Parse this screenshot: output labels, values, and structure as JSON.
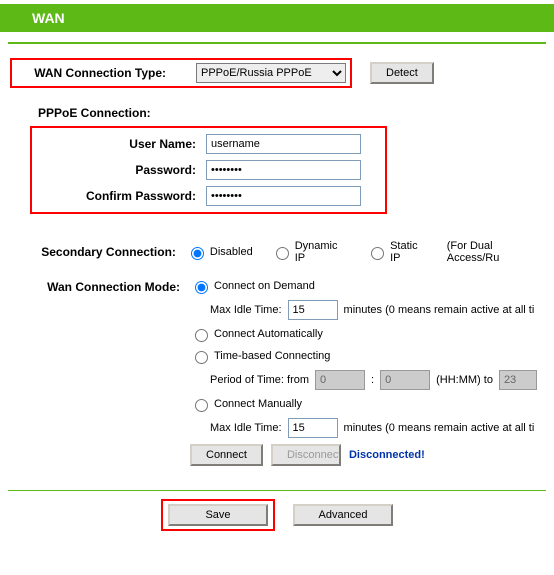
{
  "header": {
    "title": "WAN"
  },
  "wanType": {
    "label": "WAN Connection Type:",
    "selected": "PPPoE/Russia PPPoE",
    "detect": "Detect"
  },
  "pppoe": {
    "sectionTitle": "PPPoE Connection:",
    "userLabel": "User Name:",
    "userValue": "username",
    "passLabel": "Password:",
    "passValue": "password",
    "confirmLabel": "Confirm Password:",
    "confirmValue": "password"
  },
  "secondary": {
    "label": "Secondary Connection:",
    "opt1": "Disabled",
    "opt2": "Dynamic IP",
    "opt3": "Static IP",
    "note": "(For Dual Access/Ru"
  },
  "mode": {
    "label": "Wan Connection Mode:",
    "opt1": "Connect on Demand",
    "maxIdleLabel1": "Max Idle Time:",
    "maxIdleVal1": "15",
    "minutesNote": "minutes (0 means remain active at all ti",
    "opt2": "Connect Automatically",
    "opt3": "Time-based Connecting",
    "periodLabel": "Period of Time: from",
    "periodFrom": "0",
    "periodTo": "0",
    "hhmm": "(HH:MM) to",
    "periodEnd": "23",
    "opt4": "Connect Manually",
    "maxIdleLabel2": "Max Idle Time:",
    "maxIdleVal2": "15",
    "connectBtn": "Connect",
    "disconnectBtn": "Disconnect",
    "status": "Disconnected!"
  },
  "bottom": {
    "save": "Save",
    "advanced": "Advanced"
  }
}
